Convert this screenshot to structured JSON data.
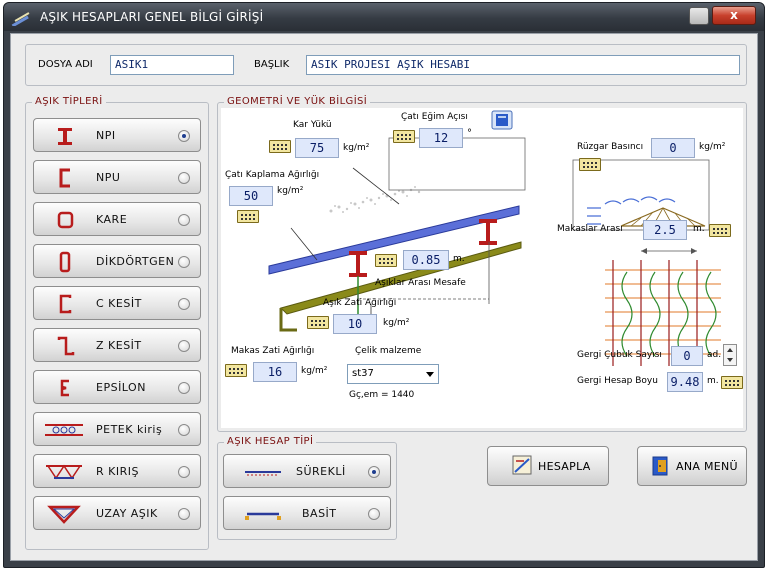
{
  "window": {
    "title": "AŞIK HESAPLARI  GENEL  BİLGİ GİRİŞİ",
    "close_label": "x"
  },
  "header": {
    "dosya_label": "DOSYA ADI",
    "dosya_value": "ASIK1",
    "baslik_label": "BAŞLIK",
    "baslik_value": "ASIK  PROJESI AŞIK HESABI"
  },
  "types": {
    "title": "AŞIK TİPLERİ",
    "items": [
      {
        "label": "NPI",
        "icon": "i-beam-icon",
        "selected": true
      },
      {
        "label": "NPU",
        "icon": "u-channel-icon",
        "selected": false
      },
      {
        "label": "KARE",
        "icon": "square-tube-icon",
        "selected": false
      },
      {
        "label": "DİKDÖRTGEN",
        "icon": "rect-tube-icon",
        "selected": false
      },
      {
        "label": "C KESİT",
        "icon": "c-section-icon",
        "selected": false
      },
      {
        "label": "Z KESİT",
        "icon": "z-section-icon",
        "selected": false
      },
      {
        "label": "EPSİLON",
        "icon": "epsilon-section-icon",
        "selected": false
      },
      {
        "label": "PETEK kiriş",
        "icon": "castellated-beam-icon",
        "selected": false
      },
      {
        "label": "R KIRIŞ",
        "icon": "r-truss-icon",
        "selected": false
      },
      {
        "label": "UZAY AŞIK",
        "icon": "space-truss-icon",
        "selected": false
      }
    ]
  },
  "geometry": {
    "title": "GEOMETRİ VE YÜK BİLGİSİ",
    "kar_label": "Kar Yükü",
    "kar_value": "75",
    "kar_unit": "kg/m²",
    "egim_label": "Çatı Eğim Açısı",
    "egim_value": "12",
    "egim_unit": "°",
    "kaplama_label": "Çatı Kaplama Ağırlığı",
    "kaplama_value": "50",
    "kaplama_unit": "kg/m²",
    "mesafe_value": "0.85",
    "mesafe_unit": "m.",
    "mesafe_label": "Aşıklar Arası Mesafe",
    "asik_zati_label": "Aşık Zati Ağırlığı",
    "asik_zati_value": "10",
    "asik_zati_unit": "kg/m²",
    "makas_zati_label": "Makas Zati Ağırlığı",
    "makas_zati_value": "16",
    "makas_zati_unit": "kg/m²",
    "celik_label": "Çelik malzeme",
    "celik_value": "st37",
    "gcem_label": "Gç,em = 1440",
    "ruzgar_label": "Rüzgar Basıncı",
    "ruzgar_value": "0",
    "ruzgar_unit": "kg/m²",
    "makaslar_label": "Makaslar Arası",
    "makaslar_value": "2.5",
    "makaslar_unit": "m.",
    "gergi_sayi_label": "Gergi Çubuk Sayısı",
    "gergi_sayi_value": "0",
    "gergi_sayi_unit": "ad.",
    "gergi_boy_label": "Gergi Hesap Boyu",
    "gergi_boy_value": "9.48",
    "gergi_boy_unit": "m."
  },
  "calc_type": {
    "title": "AŞIK HESAP TİPİ",
    "items": [
      {
        "label": "SÜREKLİ",
        "selected": true
      },
      {
        "label": "BASİT",
        "selected": false
      }
    ]
  },
  "actions": {
    "hesapla": "HESAPLA",
    "ana_menu": "ANA MENÜ"
  },
  "colors": {
    "accent_red": "#7a1010",
    "input_blue": "#dfe8fb",
    "titlebar": "#353b43"
  }
}
